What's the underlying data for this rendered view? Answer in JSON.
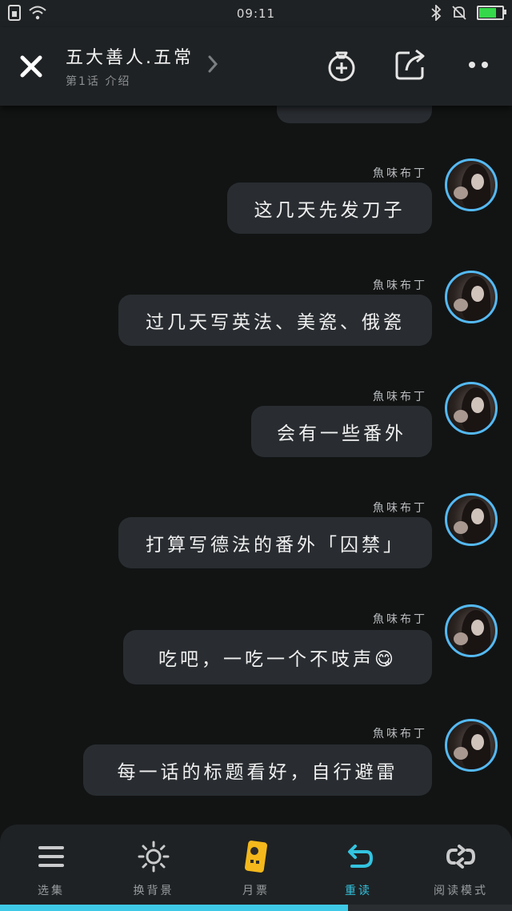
{
  "status_bar": {
    "time": "09:11",
    "battery_level": 0.8
  },
  "header": {
    "title": "五大善人.五常",
    "subtitle": "第1话 介绍"
  },
  "messages": [
    {
      "sender": "魚味布丁",
      "text": "这几天先发刀子"
    },
    {
      "sender": "魚味布丁",
      "text": "过几天写英法、美瓷、俄瓷"
    },
    {
      "sender": "魚味布丁",
      "text": "会有一些番外"
    },
    {
      "sender": "魚味布丁",
      "text": "打算写德法的番外「囚禁」"
    },
    {
      "sender": "魚味布丁",
      "text": "吃吧，一吃一个不吱声😋"
    },
    {
      "sender": "魚味布丁",
      "text": "每一话的标题看好，自行避雷"
    }
  ],
  "bottom_nav": [
    {
      "label": "选集",
      "icon": "menu-icon"
    },
    {
      "label": "换背景",
      "icon": "sun-icon"
    },
    {
      "label": "月票",
      "icon": "ticket-icon"
    },
    {
      "label": "重读",
      "icon": "replay-icon",
      "active": true
    },
    {
      "label": "阅读模式",
      "icon": "loop-icon"
    }
  ],
  "reading_progress": 0.68,
  "colors": {
    "accent": "#3ec9e6",
    "avatar_ring": "#54b9f3",
    "bubble": "#292d31"
  }
}
